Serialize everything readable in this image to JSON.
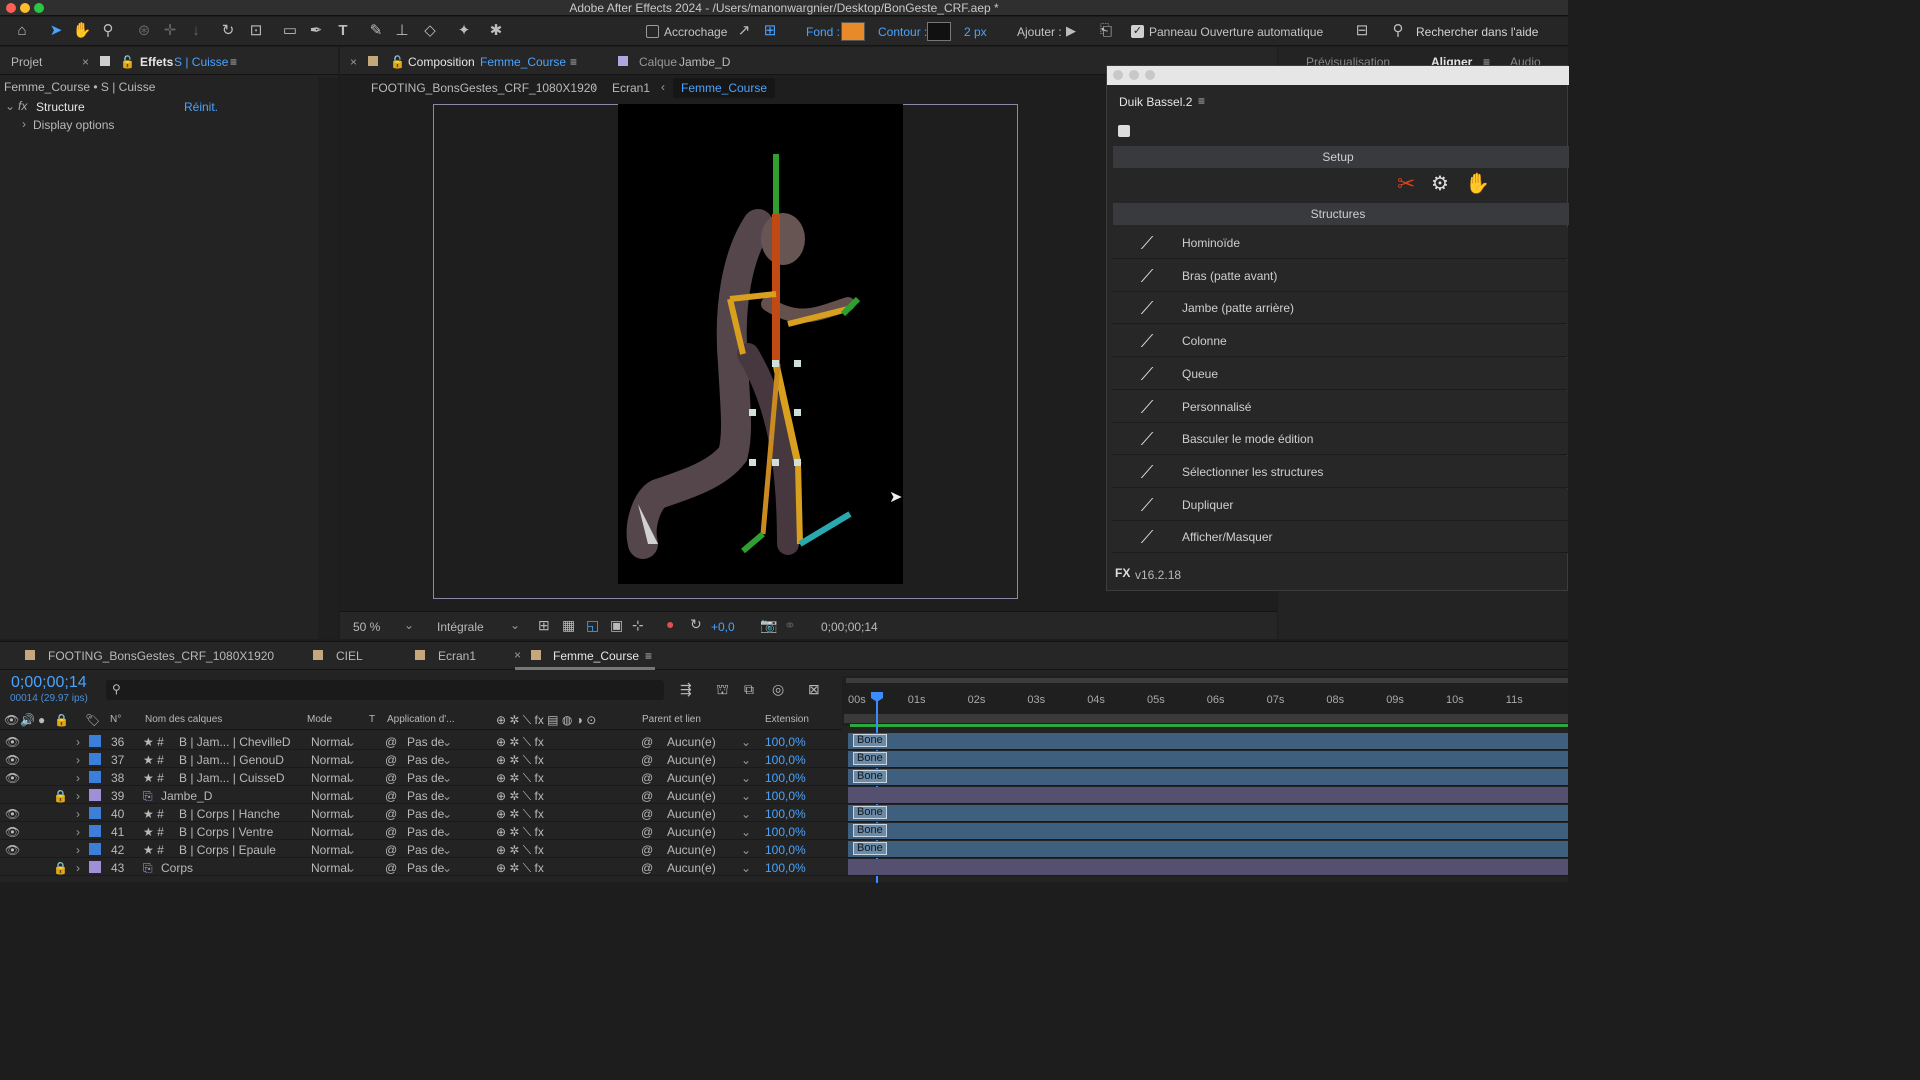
{
  "window": {
    "title": "Adobe After Effects 2024 - /Users/manonwargnier/Desktop/BonGeste_CRF.aep *"
  },
  "toolbar": {
    "snap_label": "Accrochage",
    "fill_label": "Fond :",
    "fill_color": "#e88a2a",
    "stroke_label": "Contour :",
    "stroke_width": "2 px",
    "add_label": "Ajouter :",
    "auto_open_label": "Panneau Ouverture automatique",
    "help_search": "Rechercher dans l'aide"
  },
  "left_panel": {
    "tab_project": "Projet",
    "tab_effects": "Effets",
    "effects_layer": "S | Cuisse",
    "breadcrumb": "Femme_Course • S | Cuisse",
    "fx_name": "Structure",
    "reset": "Réinit.",
    "display_options": "Display options"
  },
  "comp_panel": {
    "tab_label": "Composition",
    "comp_name": "Femme_Course",
    "layer_tab_label": "Calque",
    "layer_name": "Jambe_D",
    "nav": [
      "FOOTING_BonsGestes_CRF_1080X1920",
      "Ecran1",
      "Femme_Course"
    ],
    "zoom": "50 %",
    "resolution": "Intégrale",
    "exposure": "+0,0",
    "timecode": "0;00;00;14"
  },
  "right_tabs": [
    "Prévisualisation",
    "Aligner",
    "Audio"
  ],
  "duik": {
    "title": "Duik Bassel.2",
    "setup": "Setup",
    "structures": "Structures",
    "items": [
      {
        "label": "Hominoïde",
        "icon": "humanoid-icon"
      },
      {
        "label": "Bras (patte avant)",
        "icon": "arm-icon"
      },
      {
        "label": "Jambe (patte arrière)",
        "icon": "leg-icon"
      },
      {
        "label": "Colonne",
        "icon": "spine-icon"
      },
      {
        "label": "Queue",
        "icon": "tail-icon"
      },
      {
        "label": "Personnalisé",
        "icon": "custom-icon"
      },
      {
        "label": "Basculer le mode édition",
        "icon": "edit-mode-icon"
      },
      {
        "label": "Sélectionner les structures",
        "icon": "select-structures-icon"
      },
      {
        "label": "Dupliquer",
        "icon": "duplicate-icon"
      },
      {
        "label": "Afficher/Masquer",
        "icon": "show-hide-icon"
      }
    ],
    "version": "v16.2.18"
  },
  "timeline": {
    "tabs": [
      "FOOTING_BonsGestes_CRF_1080X1920",
      "CIEL",
      "Ecran1",
      "Femme_Course"
    ],
    "timecode": "0;00;00;14",
    "frame_info": "00014 (29.97 ips)",
    "columns": {
      "num": "N°",
      "name": "Nom des calques",
      "mode": "Mode",
      "t": "T",
      "app": "Application d'...",
      "parent": "Parent et lien",
      "ext": "Extension"
    },
    "ruler": [
      "00s",
      "01s",
      "02s",
      "03s",
      "04s",
      "05s",
      "06s",
      "07s",
      "08s",
      "09s",
      "10s",
      "11s"
    ],
    "layers": [
      {
        "num": "36",
        "name": "B | Jam... | ChevilleD",
        "mode": "Normal",
        "app": "Pas de",
        "parent": "Aucun(e)",
        "ext": "100,0%",
        "bone": "Bone",
        "color": "#3d7fd8"
      },
      {
        "num": "37",
        "name": "B | Jam... | GenouD",
        "mode": "Normal",
        "app": "Pas de",
        "parent": "Aucun(e)",
        "ext": "100,0%",
        "bone": "Bone",
        "color": "#3d7fd8"
      },
      {
        "num": "38",
        "name": "B | Jam... | CuisseD",
        "mode": "Normal",
        "app": "Pas de",
        "parent": "Aucun(e)",
        "ext": "100,0%",
        "bone": "Bone",
        "color": "#3d7fd8"
      },
      {
        "num": "39",
        "name": "Jambe_D",
        "mode": "Normal",
        "app": "Pas de",
        "parent": "Aucun(e)",
        "ext": "100,0%",
        "bone": "",
        "color": "#9e8fd6"
      },
      {
        "num": "40",
        "name": "B | Corps | Hanche",
        "mode": "Normal",
        "app": "Pas de",
        "parent": "Aucun(e)",
        "ext": "100,0%",
        "bone": "Bone",
        "color": "#3d7fd8"
      },
      {
        "num": "41",
        "name": "B | Corps | Ventre",
        "mode": "Normal",
        "app": "Pas de",
        "parent": "Aucun(e)",
        "ext": "100,0%",
        "bone": "Bone",
        "color": "#3d7fd8"
      },
      {
        "num": "42",
        "name": "B | Corps | Epaule",
        "mode": "Normal",
        "app": "Pas de",
        "parent": "Aucun(e)",
        "ext": "100,0%",
        "bone": "Bone",
        "color": "#3d7fd8"
      },
      {
        "num": "43",
        "name": "Corps",
        "mode": "Normal",
        "app": "Pas de",
        "parent": "Aucun(e)",
        "ext": "100,0%",
        "bone": "",
        "color": "#9e8fd6"
      }
    ]
  }
}
